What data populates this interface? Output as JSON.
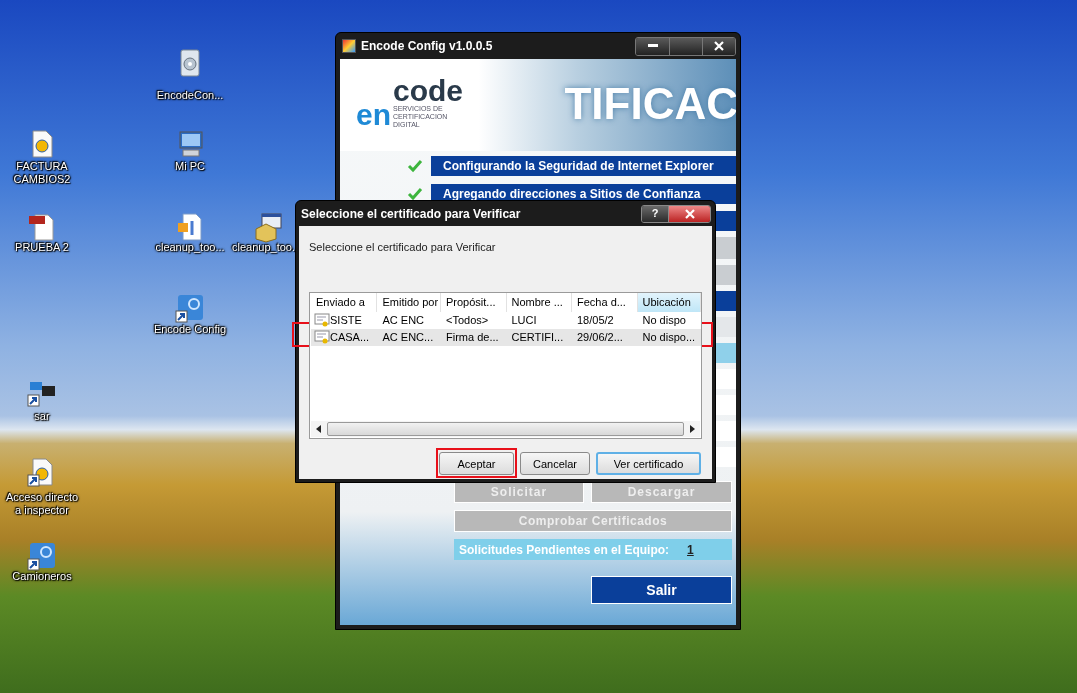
{
  "desktop_icons": [
    {
      "label": "EncodeCon...",
      "kind": "installer",
      "shortcut": false
    },
    {
      "label": "FACTURA CAMBIOS2",
      "kind": "document",
      "shortcut": false
    },
    {
      "label": "Mi PC",
      "kind": "computer",
      "shortcut": false
    },
    {
      "label": "PRUEBA 2",
      "kind": "pdf",
      "shortcut": false
    },
    {
      "label": "cleanup_too...",
      "kind": "script",
      "shortcut": false
    },
    {
      "label": "cleanup_too.",
      "kind": "package",
      "shortcut": false
    },
    {
      "label": "Encode Config",
      "kind": "app",
      "shortcut": true
    },
    {
      "label": "sar",
      "kind": "logo",
      "shortcut": true
    },
    {
      "label": "Acceso directo a inspector",
      "kind": "document",
      "shortcut": true
    },
    {
      "label": "Camioneros",
      "kind": "app",
      "shortcut": true
    }
  ],
  "encode_window": {
    "title": "Encode Config v1.0.0.5",
    "logo": {
      "left": "en",
      "right": "code",
      "tagline": "SERVICIOS DE CERTIFICACION DIGITAL"
    },
    "banner_text": "TIFICAC",
    "steps": [
      {
        "label": "Configurando la Seguridad de Internet Explorer",
        "done": true
      },
      {
        "label": "Agregando direcciones a Sitios de Confianza",
        "done": true
      }
    ],
    "buttons": [
      {
        "label": "Solicitar",
        "disabled": true
      },
      {
        "label": "Descargar",
        "disabled": true
      },
      {
        "label": "Comprobar Certificados",
        "disabled": true
      }
    ],
    "pending": {
      "label": "Solicitudes Pendientes en el Equipo:",
      "count": "1"
    },
    "exit_button": "Salir"
  },
  "dialog": {
    "title": "Seleccione el certificado para Verificar",
    "help_glyph": "?",
    "prompt": "Seleccione el certificado para Verificar",
    "columns": [
      {
        "label": "Enviado a",
        "highlighted": false
      },
      {
        "label": "Emitido por",
        "highlighted": false
      },
      {
        "label": "Propósit...",
        "highlighted": false
      },
      {
        "label": "Nombre ...",
        "highlighted": false
      },
      {
        "label": "Fecha d...",
        "highlighted": false
      },
      {
        "label": "Ubicación",
        "highlighted": true
      }
    ],
    "rows": [
      {
        "cells": [
          "SISTE",
          "AC ENC",
          "<Todos>",
          "LUCI",
          "18/05/2",
          "No dispo"
        ],
        "selected": false,
        "annotated": false
      },
      {
        "cells": [
          "CASA...",
          "AC ENC...",
          "Firma de...",
          "CERTIFI...",
          "29/06/2...",
          "No dispo..."
        ],
        "selected": true,
        "annotated": true
      }
    ],
    "buttons": [
      {
        "label": "Aceptar",
        "focused": false,
        "annotated": true
      },
      {
        "label": "Cancelar",
        "focused": false,
        "annotated": false
      },
      {
        "label": "Ver certificado",
        "focused": true,
        "annotated": false
      }
    ]
  }
}
